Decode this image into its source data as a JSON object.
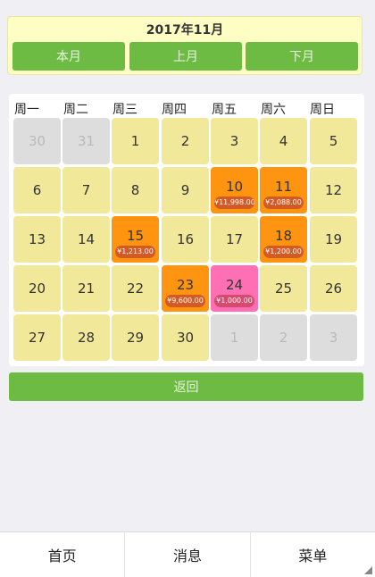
{
  "header": {
    "title": "2017年11月",
    "buttons": [
      "本月",
      "上月",
      "下月"
    ]
  },
  "weekdays": [
    "周一",
    "周二",
    "周三",
    "周四",
    "周五",
    "周六",
    "周日"
  ],
  "calendar": {
    "weeks": [
      [
        {
          "day": "30",
          "type": "other"
        },
        {
          "day": "31",
          "type": "other"
        },
        {
          "day": "1",
          "type": "normal"
        },
        {
          "day": "2",
          "type": "normal"
        },
        {
          "day": "3",
          "type": "normal"
        },
        {
          "day": "4",
          "type": "normal"
        },
        {
          "day": "5",
          "type": "normal"
        }
      ],
      [
        {
          "day": "6",
          "type": "normal"
        },
        {
          "day": "7",
          "type": "normal"
        },
        {
          "day": "8",
          "type": "normal"
        },
        {
          "day": "9",
          "type": "normal"
        },
        {
          "day": "10",
          "type": "income",
          "amount": "¥11,998.00"
        },
        {
          "day": "11",
          "type": "income",
          "amount": "¥2,088.00"
        },
        {
          "day": "12",
          "type": "normal"
        }
      ],
      [
        {
          "day": "13",
          "type": "normal"
        },
        {
          "day": "14",
          "type": "normal"
        },
        {
          "day": "15",
          "type": "income",
          "amount": "¥1,213.00"
        },
        {
          "day": "16",
          "type": "normal"
        },
        {
          "day": "17",
          "type": "normal"
        },
        {
          "day": "18",
          "type": "income",
          "amount": "¥1,200.00"
        },
        {
          "day": "19",
          "type": "normal"
        }
      ],
      [
        {
          "day": "20",
          "type": "normal"
        },
        {
          "day": "21",
          "type": "normal"
        },
        {
          "day": "22",
          "type": "normal"
        },
        {
          "day": "23",
          "type": "income",
          "amount": "¥9,600.00"
        },
        {
          "day": "24",
          "type": "pink",
          "amount": "¥1,000.00"
        },
        {
          "day": "25",
          "type": "normal"
        },
        {
          "day": "26",
          "type": "normal"
        }
      ],
      [
        {
          "day": "27",
          "type": "normal"
        },
        {
          "day": "28",
          "type": "normal"
        },
        {
          "day": "29",
          "type": "normal"
        },
        {
          "day": "30",
          "type": "normal"
        },
        {
          "day": "1",
          "type": "other"
        },
        {
          "day": "2",
          "type": "other"
        },
        {
          "day": "3",
          "type": "other"
        }
      ]
    ]
  },
  "back_label": "返回",
  "tabbar": [
    "首页",
    "消息",
    "菜单"
  ],
  "colors": {
    "accent_green": "#6dbb43",
    "normal_day": "#f2e89a",
    "other_month_day": "#dddddd",
    "income_day": "#ff9410",
    "pink_day": "#ff6fb4",
    "header_bg": "#fdfdc4"
  }
}
